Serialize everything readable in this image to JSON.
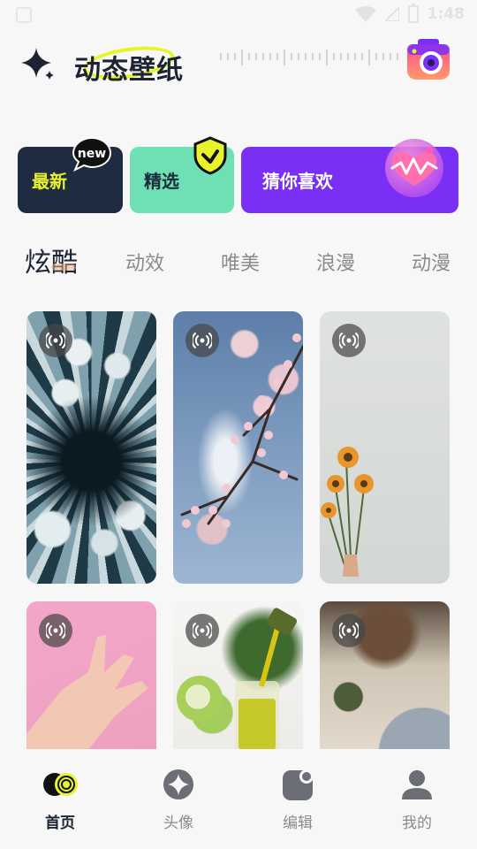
{
  "status_bar": {
    "time": "1:48"
  },
  "header": {
    "title": "动态壁纸",
    "left_icon": "sparkle-icon",
    "right_icon": "camera-icon"
  },
  "categories": [
    {
      "label": "最新",
      "badge_text": "new",
      "color": "#1e2b40"
    },
    {
      "label": "精选",
      "badge_icon": "shield-check-icon",
      "color": "#6ee0b3"
    },
    {
      "label": "猜你喜欢",
      "badge_icon": "heart-icon",
      "color": "#7a30f4"
    }
  ],
  "tabs": [
    "炫酷",
    "动效",
    "唯美",
    "浪漫",
    "动漫"
  ],
  "active_tab": "炫酷",
  "wallpapers": [
    {
      "subject": "frozen-bubbles",
      "live_icon": "live-broadcast-icon"
    },
    {
      "subject": "cherry-blossom-sky",
      "live_icon": "live-broadcast-icon"
    },
    {
      "subject": "sunflower-bouquet",
      "live_icon": "live-broadcast-icon"
    },
    {
      "subject": "hand-on-pink",
      "live_icon": "live-broadcast-icon"
    },
    {
      "subject": "juice-pouring-apples",
      "live_icon": "live-broadcast-icon"
    },
    {
      "subject": "dinner-table",
      "live_icon": "live-broadcast-icon"
    }
  ],
  "bottom_nav": [
    {
      "label": "首页",
      "icon": "home-icon",
      "active": true
    },
    {
      "label": "头像",
      "icon": "avatar-icon",
      "active": false
    },
    {
      "label": "编辑",
      "icon": "edit-icon",
      "active": false
    },
    {
      "label": "我的",
      "icon": "profile-icon",
      "active": false
    }
  ],
  "colors": {
    "accent_yellow": "#e8f32b",
    "dark_navy": "#1e2b40",
    "mint": "#6ee0b3",
    "purple": "#7a30f4"
  }
}
